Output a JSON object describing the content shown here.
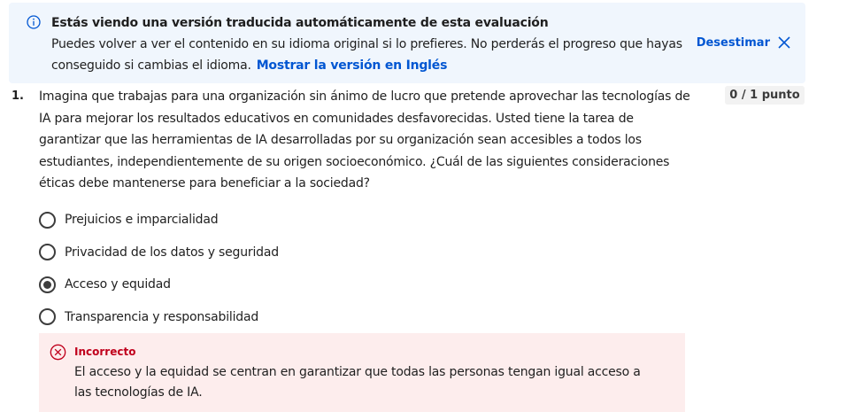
{
  "banner": {
    "title": "Estás viendo una versión traducida automáticamente de esta evaluación",
    "body": "Puedes volver a ver el contenido en su idioma original si lo prefieres. No perderás el progreso que hayas conseguido si cambias el idioma.",
    "link_label": "Mostrar la versión en Inglés",
    "dismiss_label": "Desestimar",
    "info_icon": "info-icon",
    "close_icon": "close-icon"
  },
  "question": {
    "number": "1.",
    "text": "Imagina que trabajas para una organización sin ánimo de lucro que pretende aprovechar las tecnologías de IA para mejorar los resultados educativos en comunidades desfavorecidas. Usted tiene la tarea de garantizar que las herramientas de IA desarrolladas por su organización sean accesibles a todos los estudiantes, independientemente de su origen socioeconómico. ¿Cuál de las siguientes consideraciones éticas debe mantenerse para beneficiar a la sociedad?",
    "score": "0 / 1 punto",
    "options": [
      {
        "label": "Prejuicios e imparcialidad",
        "selected": false
      },
      {
        "label": "Privacidad de los datos y seguridad",
        "selected": false
      },
      {
        "label": "Acceso y equidad",
        "selected": true
      },
      {
        "label": "Transparencia y responsabilidad",
        "selected": false
      }
    ]
  },
  "feedback": {
    "status": "Incorrecto",
    "text": "El acceso y la equidad se centran en garantizar que todas las personas tengan igual acceso a las tecnologías de IA.",
    "icon": "error-circle-icon"
  },
  "colors": {
    "link": "#0056d2",
    "banner_bg": "#f0f6fd",
    "error": "#c0001c",
    "error_bg": "#fdeded"
  }
}
